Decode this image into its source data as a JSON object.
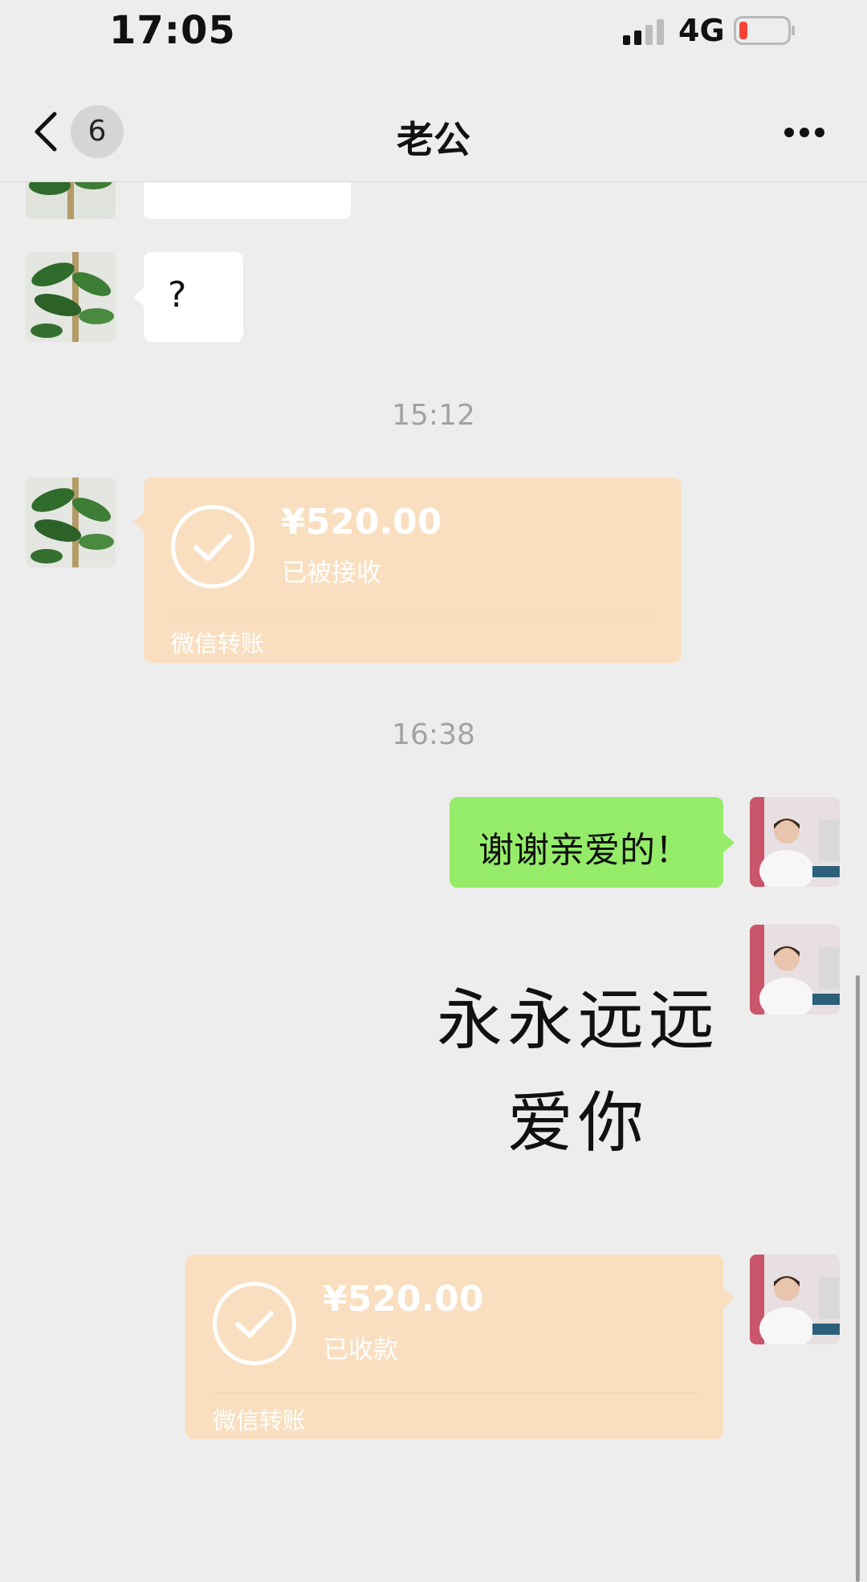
{
  "status_bar": {
    "time": "17:05",
    "network": "4G"
  },
  "nav": {
    "unread_count": "6",
    "title": "老公"
  },
  "messages": {
    "prev_partial_text": "",
    "question": "?",
    "timestamp_1": "15:12",
    "transfer_1": {
      "amount": "¥520.00",
      "status": "已被接收",
      "footer": "微信转账"
    },
    "timestamp_2": "16:38",
    "thanks": "谢谢亲爱的！",
    "sticker_line1": "永永远远",
    "sticker_line2": "爱你",
    "transfer_2": {
      "amount": "¥520.00",
      "status": "已收款",
      "footer": "微信转账"
    }
  },
  "colors": {
    "bg": "#ededed",
    "green_bubble": "#95ec69",
    "transfer_bg": "#f9dfc0",
    "battery_low": "#f44336"
  }
}
